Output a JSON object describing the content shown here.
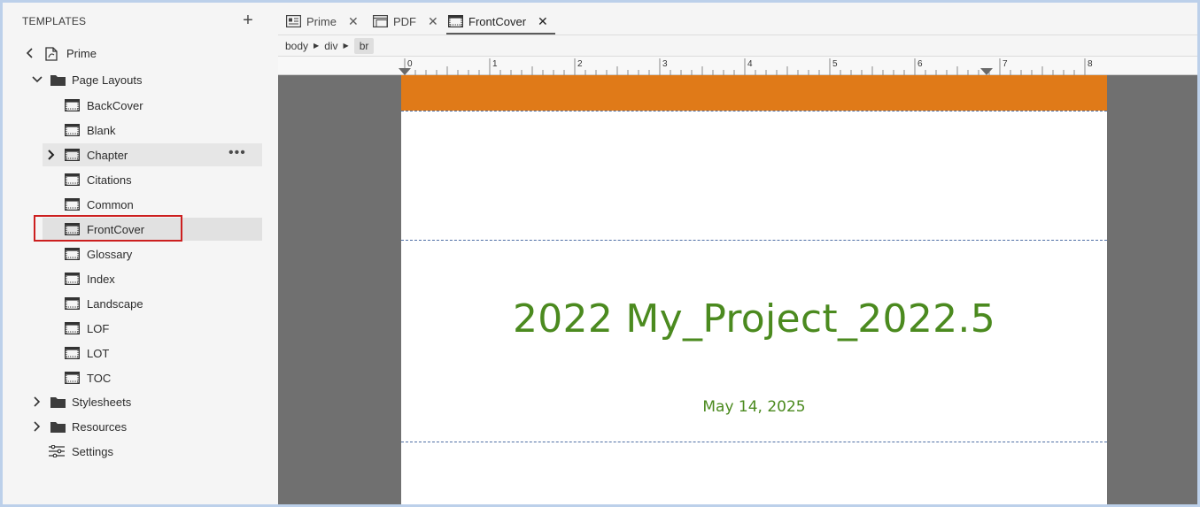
{
  "sidebar": {
    "header": "TEMPLATES",
    "add_label": "+",
    "root": {
      "label": "Prime",
      "icon": "file-icon"
    },
    "page_layouts": {
      "label": "Page Layouts",
      "items": [
        {
          "label": "BackCover"
        },
        {
          "label": "Blank"
        },
        {
          "label": "Chapter",
          "expandable": true,
          "more": "•••"
        },
        {
          "label": "Citations"
        },
        {
          "label": "Common"
        },
        {
          "label": "FrontCover",
          "selected": true
        },
        {
          "label": "Glossary"
        },
        {
          "label": "Index"
        },
        {
          "label": "Landscape"
        },
        {
          "label": "LOF"
        },
        {
          "label": "LOT"
        },
        {
          "label": "TOC"
        }
      ]
    },
    "stylesheets": {
      "label": "Stylesheets"
    },
    "resources": {
      "label": "Resources"
    },
    "settings": {
      "label": "Settings"
    }
  },
  "tabs": [
    {
      "label": "Prime",
      "close": "✕"
    },
    {
      "label": "PDF",
      "close": "✕"
    },
    {
      "label": "FrontCover",
      "close": "✕",
      "active": true
    }
  ],
  "breadcrumb": [
    "body",
    "div",
    "br"
  ],
  "ruler": {
    "labels": [
      "0",
      "1",
      "2",
      "3",
      "4",
      "5",
      "6",
      "7",
      "8"
    ]
  },
  "page": {
    "title": "2022 My_Project_2022.5",
    "date": "May 14, 2025"
  },
  "colors": {
    "band": "#e07a18",
    "title": "#4b8a1f",
    "highlight": "#cc1f1f"
  }
}
